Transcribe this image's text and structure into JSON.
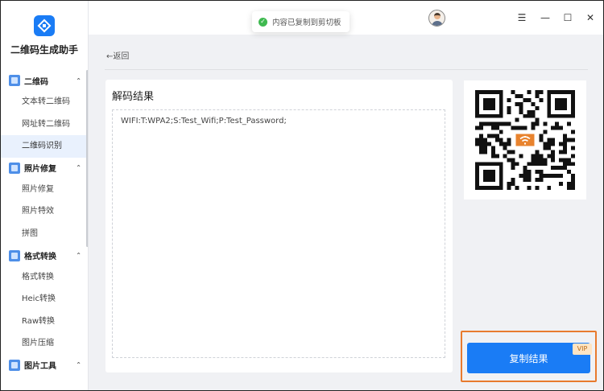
{
  "app": {
    "name": "二维码生成助手"
  },
  "sidebar": {
    "sections": [
      {
        "title": "二维码",
        "icon": "qrcode-section-icon",
        "items": [
          "文本转二维码",
          "网址转二维码",
          "二维码识别"
        ],
        "active": "二维码识别"
      },
      {
        "title": "照片修复",
        "icon": "photo-repair-section-icon",
        "items": [
          "照片修复",
          "照片特效",
          "拼图"
        ]
      },
      {
        "title": "格式转换",
        "icon": "format-convert-section-icon",
        "items": [
          "格式转换",
          "Heic转换",
          "Raw转换",
          "图片压缩"
        ]
      },
      {
        "title": "图片工具",
        "icon": "image-tools-section-icon",
        "items": []
      }
    ]
  },
  "toast": {
    "text": "内容已复制到剪切板"
  },
  "window": {
    "menu": "☰",
    "minimize": "—",
    "maximize": "☐",
    "close": "✕"
  },
  "nav": {
    "back_label": "←返回"
  },
  "result": {
    "title": "解码结果",
    "text": "WIFI:T:WPA2;S:Test_Wifi;P:Test_Password;"
  },
  "qr_center_icon": "wifi-icon",
  "copy": {
    "label": "复制结果",
    "badge": "VIP"
  },
  "colors": {
    "accent": "#1a7cf5",
    "highlight_border": "#e87a2e",
    "success": "#3fb950"
  }
}
